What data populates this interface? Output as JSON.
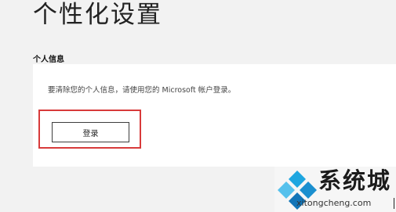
{
  "page": {
    "title": "个性化设置"
  },
  "personal_info": {
    "heading": "个人信息",
    "message": "要清除您的个人信息，请使用您的 Microsoft 帐户登录。",
    "login_button_label": "登录"
  },
  "watermark": {
    "brand": "系统城",
    "url": "xitongcheng.com",
    "logo_colors": {
      "top": "#1ea6e0",
      "left": "#56c1ec",
      "right": "#1b8fcf",
      "bottom": "#1275b8"
    }
  },
  "colors": {
    "background": "#f2f2f2",
    "card": "#ffffff",
    "highlight_border": "#d83a3a",
    "button_border": "#3d3d3d"
  }
}
